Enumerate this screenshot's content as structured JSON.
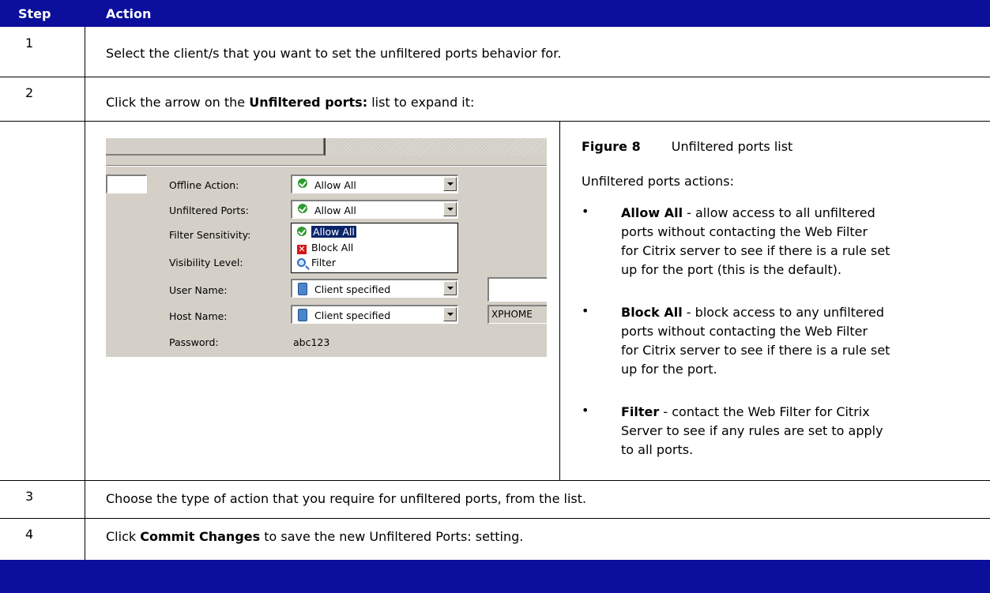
{
  "header": {
    "step_label": "Step",
    "action_label": "Action"
  },
  "rows": [
    {
      "step": "1",
      "text": "Select the client/s that you want to set the unfiltered ports behavior for."
    },
    {
      "step": "2",
      "text_before": "Click the arrow on the ",
      "bold": "Unfiltered ports:",
      "text_after": " list to expand it:"
    },
    {
      "step": "3",
      "text": "Choose the type of action that you require for unfiltered ports, from the list."
    },
    {
      "step": "4",
      "text_before": "Click ",
      "bold": "Commit Changes",
      "text_after": " to save the new Unfiltered Ports: setting."
    }
  ],
  "screenshot": {
    "fields": [
      {
        "label": "Offline Action:",
        "value": "Allow All",
        "icon": "green-check-icon"
      },
      {
        "label": "Unfiltered Ports:",
        "value": "Allow All",
        "icon": "green-check-icon"
      },
      {
        "label": "Filter Sensitivity:"
      },
      {
        "label": "Visibility Level:"
      },
      {
        "label": "User Name:",
        "value": "Client specified",
        "icon": "client-doc-icon"
      },
      {
        "label": "Host Name:",
        "value": "Client specified",
        "icon": "client-doc-icon",
        "extra": "XPHOME"
      },
      {
        "label": "Password:",
        "value": "abc123"
      }
    ],
    "dropdown_options": [
      {
        "label": "Allow All",
        "icon": "green-check-icon",
        "selected": true
      },
      {
        "label": "Block All",
        "icon": "red-x-icon"
      },
      {
        "label": "Filter",
        "icon": "magnifier-icon"
      }
    ]
  },
  "figure": {
    "label": "Figure 8",
    "title": "Unfiltered ports list"
  },
  "actions_intro": "Unfiltered ports actions:",
  "actions": [
    {
      "bullet": "•",
      "name": "Allow All",
      "line1": " - allow access to all unfiltered",
      "line2": "ports without contacting the Web Filter",
      "line3": "for Citrix server to see if there is a rule set",
      "line4": "up for the port (this is the default)."
    },
    {
      "bullet": "•",
      "name": "Block All",
      "line1": " - block access to any unfiltered",
      "line2": "ports without contacting the Web Filter",
      "line3": "for Citrix server to see if there is a rule set",
      "line4": "up for the port."
    },
    {
      "bullet": "•",
      "name": "Filter",
      "line1": " - contact the Web Filter for Citrix",
      "line2": "Server to see if any rules are set to apply",
      "line3": "to all ports."
    }
  ],
  "colors": {
    "header_bg": "#0b0f9c",
    "footer_bg": "#0b0f9c"
  }
}
